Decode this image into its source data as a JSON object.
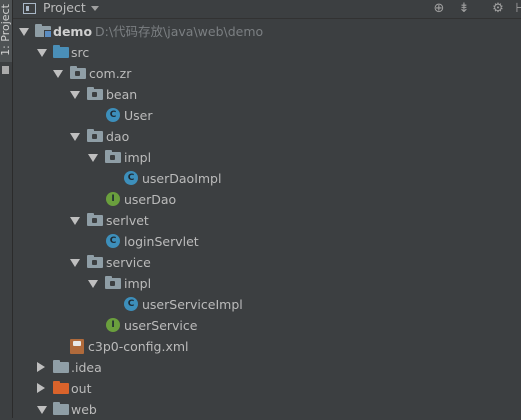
{
  "side_tab": {
    "label": "1: Project"
  },
  "header": {
    "title": "Project"
  },
  "tree": {
    "rows": [
      {
        "label": "demo",
        "path": "D:\\代码存放\\java\\web\\demo"
      },
      {
        "label": "src"
      },
      {
        "label": "com.zr"
      },
      {
        "label": "bean"
      },
      {
        "label": "User",
        "badge": "C"
      },
      {
        "label": "dao"
      },
      {
        "label": "impl"
      },
      {
        "label": "userDaoImpl",
        "badge": "C"
      },
      {
        "label": "userDao",
        "badge": "I"
      },
      {
        "label": "serlvet"
      },
      {
        "label": "loginServlet",
        "badge": "C"
      },
      {
        "label": "service"
      },
      {
        "label": "impl"
      },
      {
        "label": "userServiceImpl",
        "badge": "C"
      },
      {
        "label": "userService",
        "badge": "I"
      },
      {
        "label": "c3p0-config.xml"
      },
      {
        "label": ".idea"
      },
      {
        "label": "out"
      },
      {
        "label": "web"
      }
    ]
  },
  "colors": {
    "background": "#3c3f41",
    "text": "#bbbbbb",
    "class_icon": "#3d8fbb",
    "interface_icon": "#6a9f3d",
    "out_folder": "#d9632b",
    "source_folder": "#4a8fb8"
  }
}
